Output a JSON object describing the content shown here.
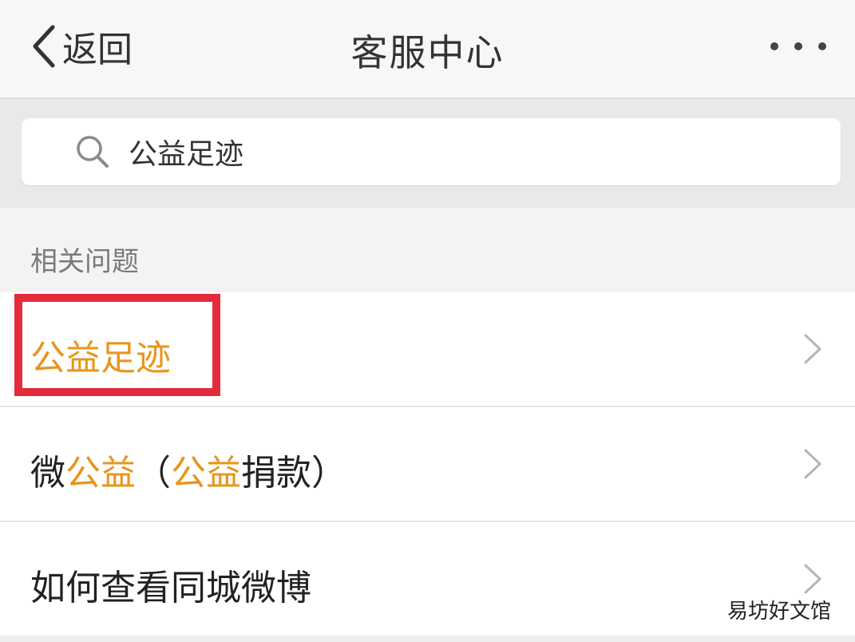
{
  "nav": {
    "back_label": "返回",
    "title": "客服中心",
    "more_icon": "more-dots-icon"
  },
  "search": {
    "value": "公益足迹",
    "icon": "search-icon"
  },
  "section": {
    "heading": "相关问题"
  },
  "rows": [
    {
      "parts": [
        {
          "text": "公益足迹",
          "highlight": true
        }
      ],
      "highlighted_box": true
    },
    {
      "parts": [
        {
          "text": "微",
          "highlight": false
        },
        {
          "text": "公益",
          "highlight": true
        },
        {
          "text": "（",
          "highlight": false
        },
        {
          "text": "公益",
          "highlight": true
        },
        {
          "text": "捐款）",
          "highlight": false
        }
      ]
    },
    {
      "parts": [
        {
          "text": "如何查看同城微博",
          "highlight": false
        }
      ]
    }
  ],
  "watermark": "易坊好文馆",
  "colors": {
    "highlight": "#e8951c",
    "annotation_box": "#e32b3c"
  }
}
